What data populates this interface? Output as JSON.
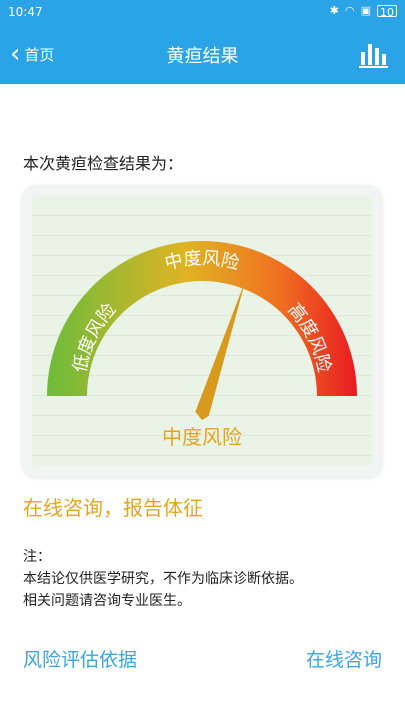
{
  "status_bar": {
    "time": "10:47",
    "icons": [
      "bluetooth-icon",
      "wifi-icon",
      "sim-icon",
      "battery-icon"
    ],
    "battery": "10"
  },
  "nav": {
    "back_label": "首页",
    "title": "黄疸结果",
    "right_icon": "bar-chart-icon"
  },
  "result_heading": "本次黄疸检查结果为：",
  "gauge": {
    "left_label": "低度风险",
    "top_label": "中度风险",
    "right_label": "高度风险",
    "result_label": "中度风险",
    "needle_fraction": 0.6,
    "colors": {
      "low": "#6dbb3c",
      "mid": "#e0b422",
      "high": "#e81b22",
      "needle": "#d89a1c",
      "labels": "#ffffff",
      "result": "#e5a41f"
    }
  },
  "consult_line": "在线咨询，报告体征",
  "note": {
    "title": "注：",
    "line1": "本结论仅供医学研究，不作为临床诊断依据。",
    "line2": "相关问题请咨询专业医生。"
  },
  "bottom": {
    "left_link": "风险评估依据",
    "right_link": "在线咨询"
  },
  "colors": {
    "primary": "#2aa4e6",
    "link": "#3aa5de",
    "accent": "#e5a41f"
  }
}
